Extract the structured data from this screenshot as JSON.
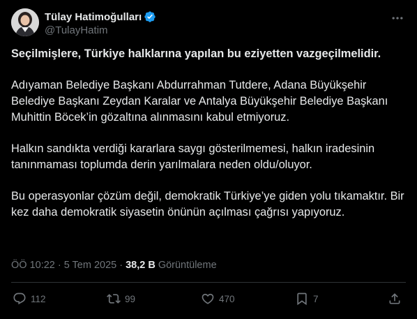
{
  "author": {
    "display_name": "Tülay Hatimoğulları",
    "handle": "@TulayHatim"
  },
  "tweet": {
    "paragraphs": [
      "Seçilmişlere, Türkiye halklarına yapılan bu eziyetten vazgeçilmelidir.",
      "Adıyaman Belediye Başkanı Abdurrahman Tutdere, Adana Büyükşehir Belediye Başkanı Zeydan Karalar ve Antalya Büyükşehir Belediye Başkanı Muhittin Böcek’in gözaltına alınmasını kabul etmiyoruz.",
      "Halkın sandıkta verdiği kararlara saygı gösterilmemesi, halkın iradesinin tanınmaması toplumda derin yarılmalara neden oldu/oluyor.",
      "Bu operasyonlar çözüm değil, demokratik Türkiye’ye giden yolu tıkamaktır. Bir kez daha demokratik siyasetin önünün açılması çağrısı yapıyoruz."
    ]
  },
  "meta": {
    "time": "ÖÖ 10:22",
    "separator": "·",
    "date": "5 Tem 2025",
    "views_count": "38,2 B",
    "views_label": "Görüntüleme"
  },
  "actions": {
    "replies": "112",
    "reposts": "99",
    "likes": "470",
    "bookmarks": "7"
  },
  "icons": {
    "verified": "verified-badge-icon",
    "more": "more-icon",
    "reply": "reply-icon",
    "repost": "repost-icon",
    "like": "heart-icon",
    "bookmark": "bookmark-icon",
    "share": "share-icon"
  },
  "colors": {
    "background": "#000000",
    "text": "#e7e9ea",
    "secondary": "#71767b",
    "verified": "#1d9bf0",
    "divider": "#2f3336"
  }
}
